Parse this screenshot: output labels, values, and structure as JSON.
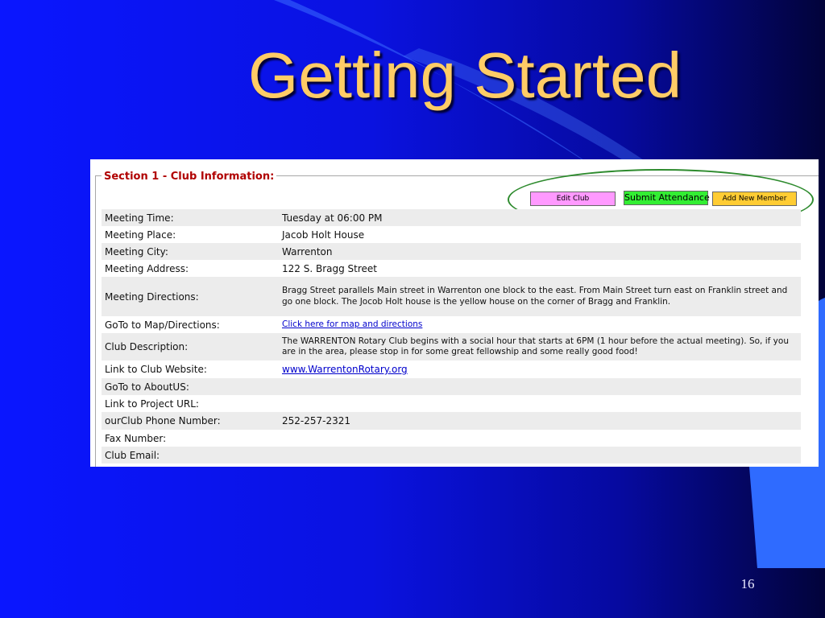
{
  "slide": {
    "title": "Getting Started",
    "page_number": "16",
    "colors": {
      "background": "#0a16ff",
      "title": "#ffcc66",
      "accent_curve": "#2f6bff"
    }
  },
  "section": {
    "legend": "Section 1 - Club Information:"
  },
  "buttons": {
    "edit_club": "Edit Club",
    "submit_attendance": "Submit Attendance",
    "add_new_member": "Add New Member"
  },
  "rows": [
    {
      "label": "Meeting Time:",
      "value": "Tuesday at 06:00 PM"
    },
    {
      "label": "Meeting Place:",
      "value": "Jacob Holt House"
    },
    {
      "label": "Meeting City:",
      "value": "Warrenton"
    },
    {
      "label": "Meeting Address:",
      "value": "122 S. Bragg Street"
    },
    {
      "label": "Meeting Directions:",
      "value": "Bragg Street parallels Main street in Warrenton one block to the east. From Main Street turn east on Franklin street and go one block. The Jocob Holt house is the yellow house on the corner of Bragg and Franklin."
    },
    {
      "label": "GoTo to Map/Directions:",
      "value": "Click here for map and directions"
    },
    {
      "label": "Club Description:",
      "value": "The WARRENTON Rotary Club begins with a social hour that starts at 6PM (1 hour before the actual meeting). So, if you are in the area, please stop in for some great fellowship and some really good food!"
    },
    {
      "label": "Link to Club Website:",
      "value": "www.WarrentonRotary.org"
    },
    {
      "label": "GoTo to AboutUS:",
      "value": ""
    },
    {
      "label": "Link to Project URL:",
      "value": ""
    },
    {
      "label": "ourClub Phone Number:",
      "value": "252-257-2321"
    },
    {
      "label": "Fax Number:",
      "value": ""
    },
    {
      "label": "Club Email:",
      "value": ""
    }
  ]
}
